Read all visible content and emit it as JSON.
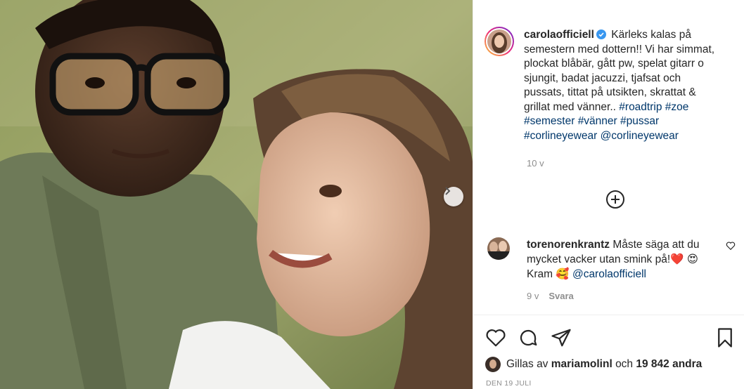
{
  "post": {
    "username": "carolaofficiell",
    "caption_text": "Kärleks kalas på semestern med dottern!! Vi har simmat, plockat blåbär, gått pw, spelat gitarr o sjungit, badat jacuzzi, tjafsat och pussats, tittat på utsikten, skrattat & grillat med vänner..",
    "hashtags": [
      "#roadtrip",
      "#zoe",
      "#semester",
      "#vänner",
      "#pussar",
      "#corlineyewear"
    ],
    "mention": "@corlineyewear",
    "time_ago": "10 v"
  },
  "comment": {
    "username": "torenorenkrantz",
    "text": "Måste säga att du mycket vacker utan smink på!❤️ 😍 Kram 🥰",
    "mention": "@carolaofficiell",
    "time_ago": "9 v",
    "reply_label": "Svara"
  },
  "likes": {
    "prefix": "Gillas av",
    "user": "mariamolinl",
    "connector": "och",
    "count_text": "19 842 andra"
  },
  "date": "DEN 19 JULI",
  "icons": {
    "verified": "verified-badge-icon",
    "load_more": "plus-circle-icon",
    "like": "heart-icon",
    "comment": "comment-icon",
    "share": "share-icon",
    "save": "bookmark-icon",
    "next": "chevron-right-icon"
  },
  "colors": {
    "link": "#00376b",
    "verified": "#3897f0",
    "muted": "#8e8e8e"
  }
}
